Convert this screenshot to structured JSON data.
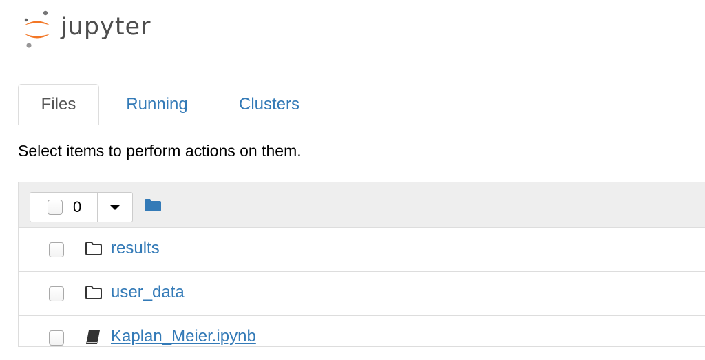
{
  "app": {
    "logo_text": "jupyter"
  },
  "tabs": [
    {
      "label": "Files",
      "active": true
    },
    {
      "label": "Running",
      "active": false
    },
    {
      "label": "Clusters",
      "active": false
    }
  ],
  "instructions": "Select items to perform actions on them.",
  "toolbar": {
    "selected_count": "0",
    "home_icon": "folder-icon"
  },
  "files": [
    {
      "name": "results",
      "type": "folder",
      "icon": "folder-outline-icon"
    },
    {
      "name": "user_data",
      "type": "folder",
      "icon": "folder-outline-icon"
    },
    {
      "name": "Kaplan_Meier.ipynb",
      "type": "notebook",
      "icon": "notebook-icon"
    }
  ],
  "colors": {
    "link": "#337ab7",
    "logo_orange": "#f37726",
    "header_bg": "#eeeeee",
    "border": "#dddddd"
  }
}
